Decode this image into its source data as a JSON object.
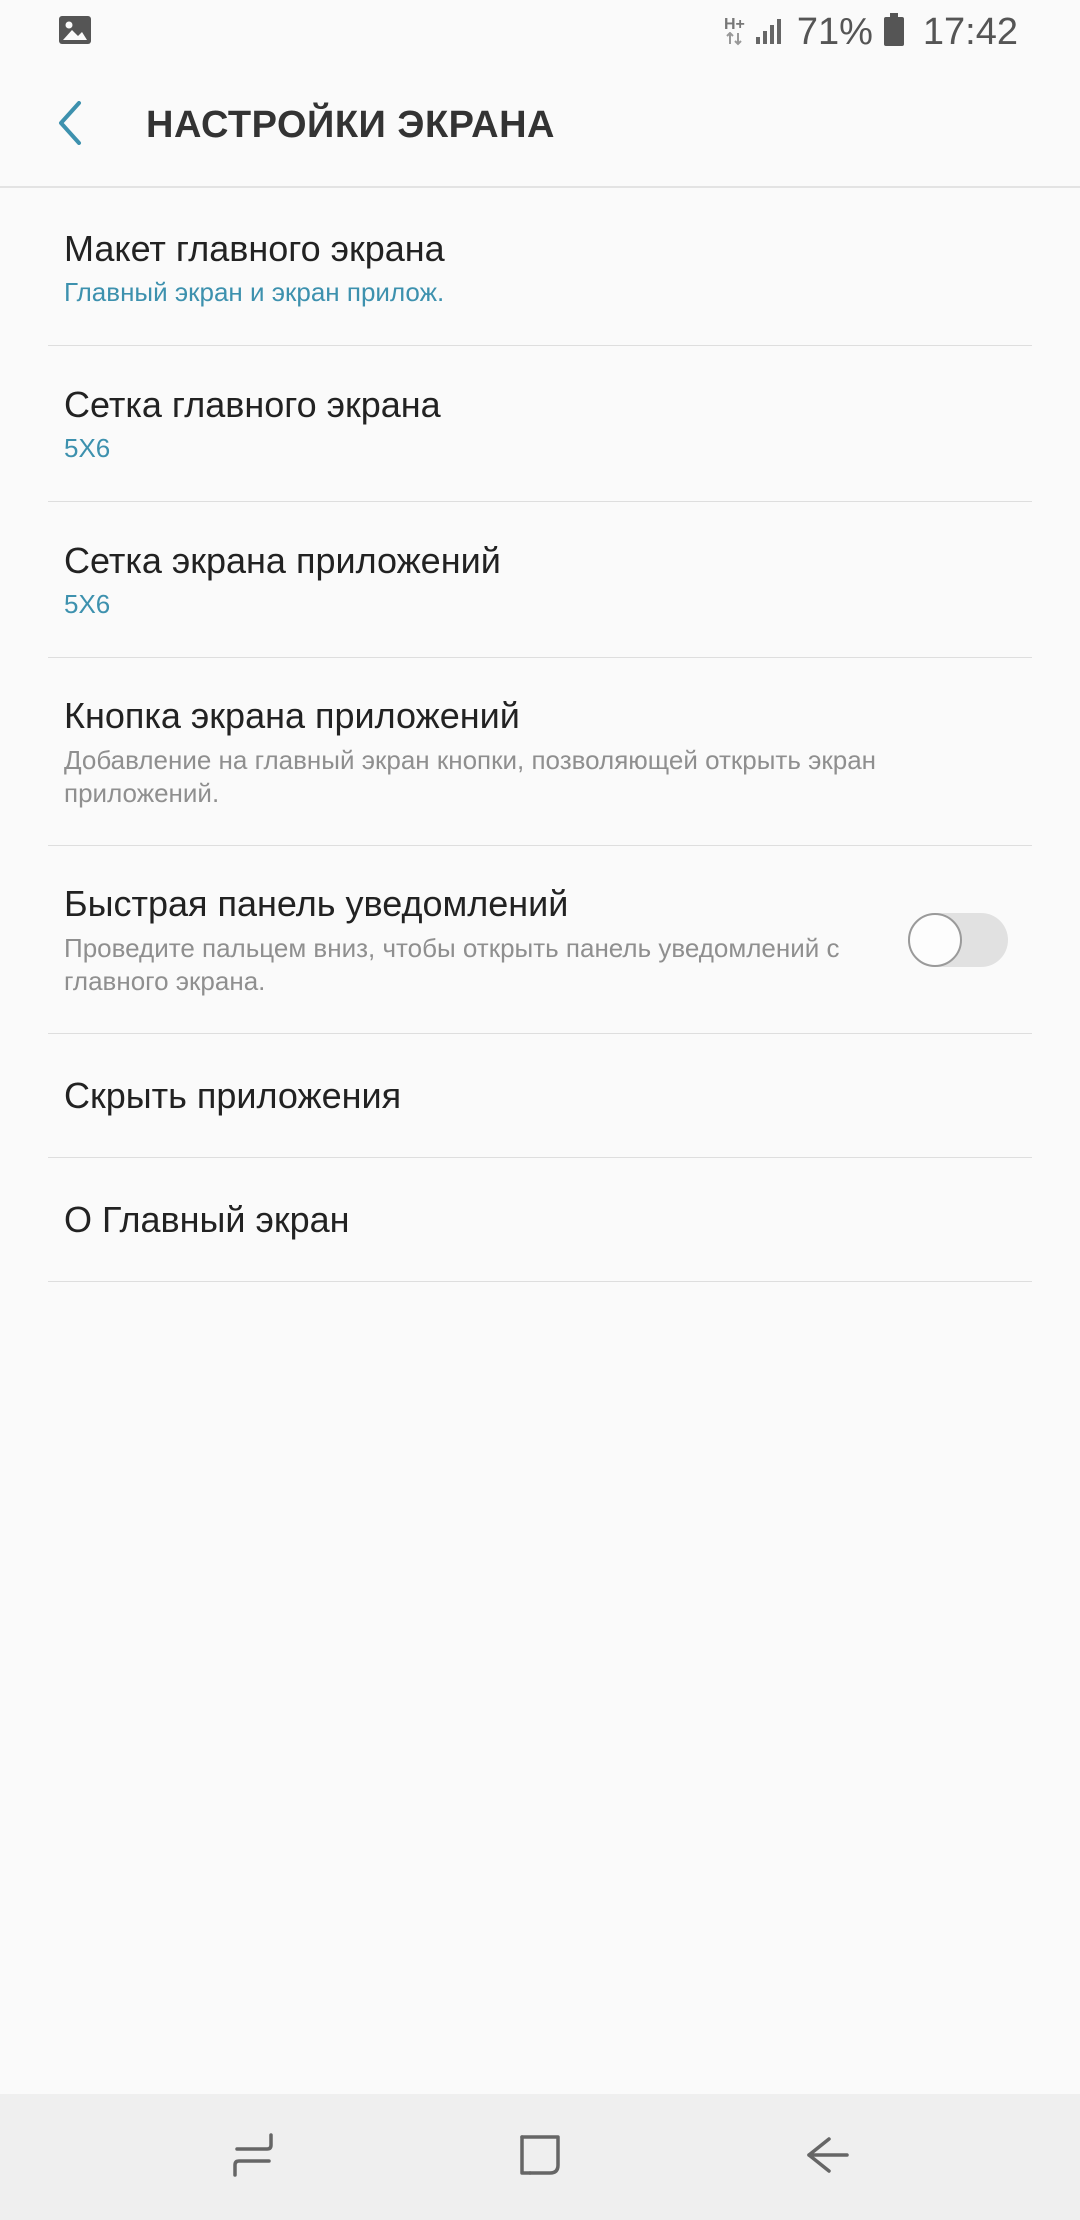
{
  "status_bar": {
    "network_type": "H+",
    "battery_percent": "71%",
    "time": "17:42",
    "icons": [
      "gallery-icon",
      "signal-icon",
      "battery-icon"
    ]
  },
  "app_bar": {
    "title": "НАСТРОЙКИ ЭКРАНА",
    "back_icon": "chevron-left-icon"
  },
  "settings": {
    "items": [
      {
        "title": "Макет главного экрана",
        "summary": "Главный экран и экран прилож."
      },
      {
        "title": "Сетка главного экрана",
        "summary": "5X6"
      },
      {
        "title": "Сетка экрана приложений",
        "summary": "5X6"
      },
      {
        "title": "Кнопка экрана приложений",
        "summary": "Добавление на главный экран кнопки, позволяющей открыть экран приложений."
      },
      {
        "title": "Быстрая панель уведомлений",
        "summary": "Проведите пальцем вниз, чтобы открыть панель уведомлений с главного экрана.",
        "toggle_on": false
      },
      {
        "title": "Скрыть приложения"
      },
      {
        "title": "О Главный экран"
      }
    ]
  },
  "nav_bar": {
    "buttons": [
      "recents-icon",
      "home-icon",
      "back-icon"
    ]
  },
  "colors": {
    "accent": "#3d91ae",
    "background": "#fafafa",
    "divider": "#dedede",
    "secondary_text": "#8f8f8f"
  }
}
